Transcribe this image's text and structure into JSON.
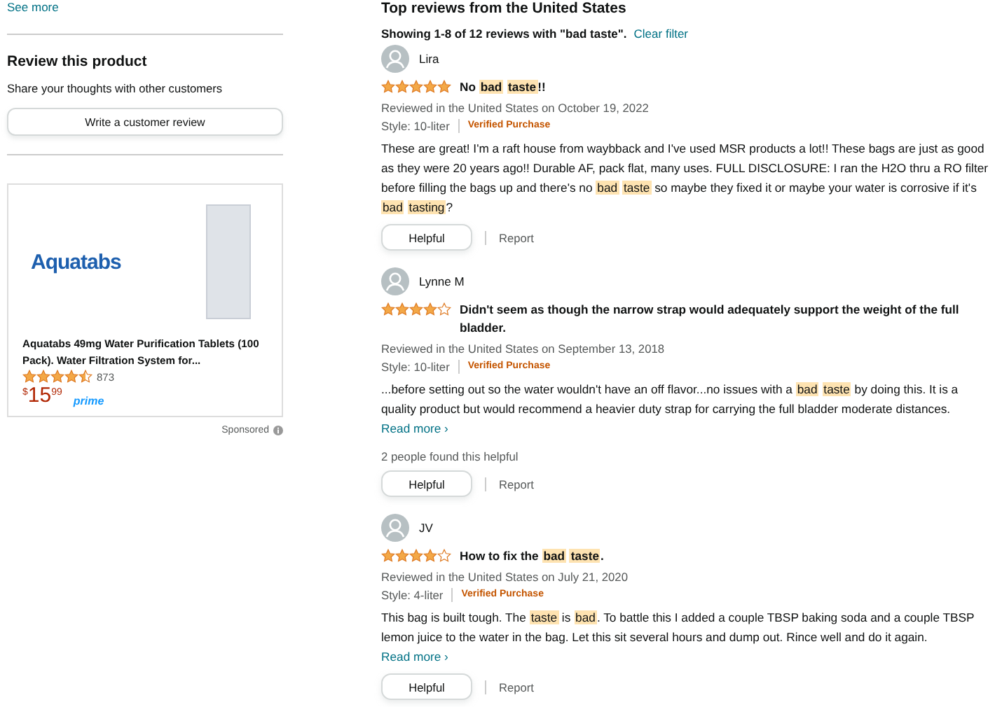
{
  "sidebar": {
    "see_more": "See more",
    "heading": "Review this product",
    "subtext": "Share your thoughts with other customers",
    "write_button": "Write a customer review",
    "ad": {
      "logo_text": "Aquatabs",
      "title": "Aquatabs 49mg Water Purification Tablets (100 Pack). Water Filtration System for...",
      "stars": 4.5,
      "rating_count": "873",
      "price_symbol": "$",
      "price_whole": "15",
      "price_fraction": "99",
      "prime": "prime",
      "sponsored": "Sponsored"
    }
  },
  "reviews_section": {
    "heading": "Top reviews from the United States",
    "filter_summary": "Showing 1-8 of 12 reviews with \"bad taste\".",
    "clear_filter": "Clear filter",
    "reviews": [
      {
        "name": "Lira",
        "stars": 5,
        "title": [
          {
            "text": "No "
          },
          {
            "text": "bad taste",
            "highlight": true
          },
          {
            "text": "!!"
          }
        ],
        "date": "Reviewed in the United States on October 19, 2022",
        "style": "Style: 10-liter",
        "verified": "Verified Purchase",
        "body": [
          {
            "text": "These are great! I'm a raft house from waybback and I've used MSR products a lot!! These bags are just as good as they were 20 years ago!! Durable AF, pack flat, many uses. FULL DISCLOSURE: I ran the H2O thru a RO filter before filling the bags up and there's no "
          },
          {
            "text": "bad taste",
            "highlight": true
          },
          {
            "text": " so maybe they fixed it or maybe your water is corrosive if it's "
          },
          {
            "text": "bad tasting",
            "highlight": true
          },
          {
            "text": "?"
          }
        ],
        "helpful_button": "Helpful",
        "report": "Report"
      },
      {
        "name": "Lynne M",
        "stars": 4,
        "title": [
          {
            "text": "Didn't seem as though the narrow strap would adequately support the weight of the full bladder."
          }
        ],
        "date": "Reviewed in the United States on September 13, 2018",
        "style": "Style: 10-liter",
        "verified": "Verified Purchase",
        "body": [
          {
            "text": "...before setting out so the water wouldn't have an off flavor...no issues with a "
          },
          {
            "text": "bad taste",
            "highlight": true
          },
          {
            "text": " by doing this. It is a quality product but would recommend a heavier duty strap for carrying the full bladder moderate distances."
          }
        ],
        "read_more": "Read more ›",
        "helpful_count": "2 people found this helpful",
        "helpful_button": "Helpful",
        "report": "Report"
      },
      {
        "name": "JV",
        "stars": 4,
        "title": [
          {
            "text": "How to fix the "
          },
          {
            "text": "bad taste",
            "highlight": true
          },
          {
            "text": "."
          }
        ],
        "date": "Reviewed in the United States on July 21, 2020",
        "style": "Style: 4-liter",
        "verified": "Verified Purchase",
        "body": [
          {
            "text": "This bag is built tough. The "
          },
          {
            "text": "taste",
            "highlight": true
          },
          {
            "text": " is "
          },
          {
            "text": "bad",
            "highlight": true
          },
          {
            "text": ". To battle this I added a couple TBSP baking soda and a couple TBSP lemon juice to the water in the bag. Let this sit several hours and dump out. Rince well and do it again."
          }
        ],
        "read_more": "Read more ›",
        "helpful_button": "Helpful",
        "report": "Report"
      }
    ]
  }
}
